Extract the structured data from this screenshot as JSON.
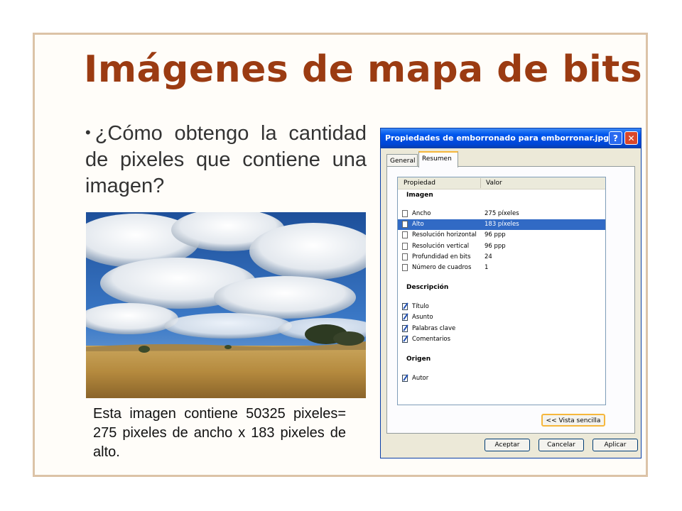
{
  "slide": {
    "title": "Imágenes de mapa de bits",
    "bullet": "¿Cómo obtengo la cantidad de pixeles que contiene una imagen?",
    "caption": "Esta imagen contiene 50325 pixeles= 275 pixeles de ancho x 183 pixeles de alto.",
    "title_color": "#9b3b12",
    "frame_color": "#dcc3a7"
  },
  "dialog": {
    "title": "Propiedades de emborronado para emborronar.jpg",
    "help_label": "?",
    "close_label": "✕",
    "tabs": [
      "General",
      "Resumen"
    ],
    "active_tab": "Resumen",
    "columns": [
      "Propiedad",
      "Valor"
    ],
    "sections": {
      "imagen": "Imagen",
      "descripcion": "Descripción",
      "origen": "Origen"
    },
    "imagen_rows": [
      {
        "k": "Ancho",
        "v": "275 píxeles"
      },
      {
        "k": "Alto",
        "v": "183 píxeles"
      },
      {
        "k": "Resolución horizontal",
        "v": "96 ppp"
      },
      {
        "k": "Resolución vertical",
        "v": "96 ppp"
      },
      {
        "k": "Profundidad en bits",
        "v": "24"
      },
      {
        "k": "Número de cuadros",
        "v": "1"
      }
    ],
    "selected_row": "Alto",
    "descripcion_rows": [
      "Título",
      "Asunto",
      "Palabras clave",
      "Comentarios"
    ],
    "origen_rows": [
      "Autor"
    ],
    "buttons": {
      "vista": "<< Vista sencilla",
      "ok": "Aceptar",
      "cancel": "Cancelar",
      "apply": "Aplicar"
    },
    "accent": "#0058ee",
    "selection": "#316ac5"
  }
}
